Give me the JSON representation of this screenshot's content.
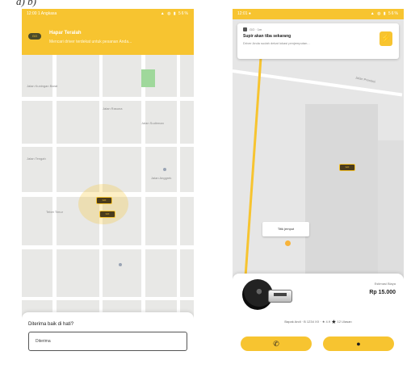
{
  "caption": "a)    b)",
  "left_phone": {
    "status": {
      "time": "12:00 1 Angkasa",
      "icons": "▲ ◍ ▮ 56%"
    },
    "notification": {
      "badge": "GO",
      "title": "Hapar Teralah",
      "subtitle": "Mencari driver terdekat untuk pesanan Anda..."
    },
    "map_labels": {
      "area1": "Jalan Kuningan Barat",
      "area2": "Jalan Rasuna",
      "area3": "Jalan Sudirman",
      "area4": "Jalan Anggrek",
      "area5": "Jalan Tengah",
      "area6": "Tebet Timur"
    },
    "marker_label": "GO",
    "sheet": {
      "question": "Diterima baik di hati?",
      "input_value": "Diterima"
    }
  },
  "right_phone": {
    "status": {
      "time": "12:01 ●",
      "icons": "▲ ◍ ▮ 56%"
    },
    "notification": {
      "app": "GO · 1m",
      "title": "Supir akan tiba sekarang",
      "subtitle": "Driver Anda sudah dekat lokasi penjemputan...",
      "logo": "⚡"
    },
    "map_labels": {
      "street": "Jalan Prestasi"
    },
    "car_label": "GO",
    "callout": "Titik jemput",
    "driver": {
      "price_label": "Estimasi Biaya",
      "price": "Rp 15.000",
      "rating_line_left": "Bapak Andi · B 1234 XX · ★ 4.9",
      "rating_line_right": "12 Ulasan",
      "star": "★"
    },
    "buttons": {
      "call_icon": "✆",
      "chat_icon": "●"
    }
  }
}
